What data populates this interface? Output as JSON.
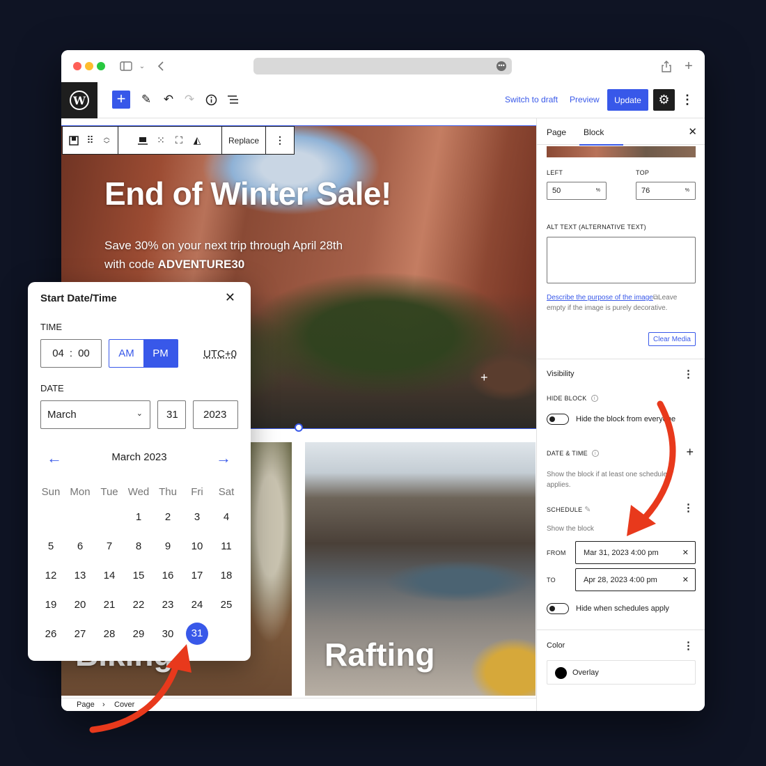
{
  "toolbar": {
    "switch_to_draft": "Switch to draft",
    "preview": "Preview",
    "update": "Update",
    "logo": "W"
  },
  "block_toolbar": {
    "replace": "Replace"
  },
  "cover": {
    "title": "End of Winter Sale!",
    "subtitle_line1": "Save 30% on your next trip through April 28th",
    "subtitle_prefix": "with code ",
    "code": "ADVENTURE30"
  },
  "cards": [
    {
      "title": "Biking"
    },
    {
      "title": "Rafting"
    }
  ],
  "breadcrumb": {
    "items": [
      "Page",
      "Cover"
    ]
  },
  "sidebar": {
    "tabs": [
      "Page",
      "Block"
    ],
    "left_label": "LEFT",
    "left_value": "50",
    "top_label": "TOP",
    "top_value": "76",
    "unit": "%",
    "alt_label": "ALT TEXT (ALTERNATIVE TEXT)",
    "alt_help_link": "Describe the purpose of the image",
    "alt_help_text": "Leave empty if the image is purely decorative.",
    "clear_media": "Clear Media",
    "visibility_title": "Visibility",
    "hide_block_label": "HIDE BLOCK",
    "hide_block_toggle": "Hide the block from everyone",
    "date_time_label": "DATE & TIME",
    "date_time_help": "Show the block if at least one schedule applies.",
    "schedule_label": "SCHEDULE",
    "schedule_desc": "Show the block",
    "from_label": "FROM",
    "from_value": "Mar 31, 2023 4:00 pm",
    "to_label": "TO",
    "to_value": "Apr 28, 2023 4:00 pm",
    "hide_when_toggle": "Hide when schedules apply",
    "color_title": "Color",
    "overlay_label": "Overlay"
  },
  "popover": {
    "title": "Start Date/Time",
    "time_label": "TIME",
    "hours": "04",
    "minutes": "00",
    "am": "AM",
    "pm": "PM",
    "timezone": "UTC+0",
    "date_label": "DATE",
    "month_select": "March",
    "day": "31",
    "year": "2023",
    "month_heading": "March 2023",
    "weekdays": [
      "Sun",
      "Mon",
      "Tue",
      "Wed",
      "Thu",
      "Fri",
      "Sat"
    ],
    "weeks": [
      [
        "",
        "",
        "",
        "1",
        "2",
        "3",
        "4"
      ],
      [
        "5",
        "6",
        "7",
        "8",
        "9",
        "10",
        "11"
      ],
      [
        "12",
        "13",
        "14",
        "15",
        "16",
        "17",
        "18"
      ],
      [
        "19",
        "20",
        "21",
        "22",
        "23",
        "24",
        "25"
      ],
      [
        "26",
        "27",
        "28",
        "29",
        "30",
        "31",
        ""
      ]
    ],
    "selected_day": "31"
  },
  "colors": {
    "accent": "#3858e9",
    "annotation_arrow": "#e8391c",
    "background": "#0f1424"
  }
}
